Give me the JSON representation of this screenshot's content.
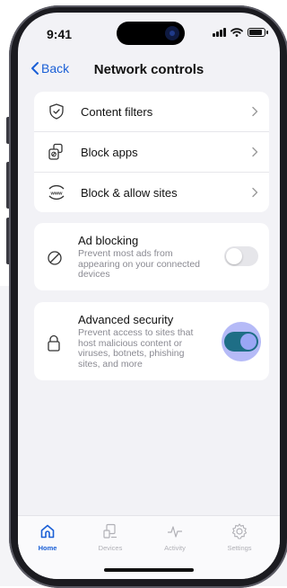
{
  "status_bar": {
    "time": "9:41"
  },
  "nav": {
    "back_label": "Back",
    "title": "Network controls"
  },
  "menu": [
    {
      "label": "Content filters",
      "icon": "shield-check-icon"
    },
    {
      "label": "Block apps",
      "icon": "block-apps-icon"
    },
    {
      "label": "Block & allow sites",
      "icon": "www-icon"
    }
  ],
  "ad_blocking": {
    "title": "Ad blocking",
    "desc_lines": [
      "Prevent most ads from",
      "appearing on your connected",
      "devices"
    ],
    "enabled": false
  },
  "advanced_security": {
    "title": "Advanced security",
    "desc_lines": [
      "Prevent access to sites that",
      "host malicious content or",
      "viruses, botnets, phishing",
      "sites, and more"
    ],
    "enabled": true
  },
  "tabs": [
    {
      "label": "Home",
      "active": true
    },
    {
      "label": "Devices",
      "active": false
    },
    {
      "label": "Activity",
      "active": false
    },
    {
      "label": "Settings",
      "active": false
    }
  ],
  "colors": {
    "accent": "#1a5fd6",
    "toggle_on": "#1e6e86",
    "toggle_halo": "#7882f0"
  }
}
